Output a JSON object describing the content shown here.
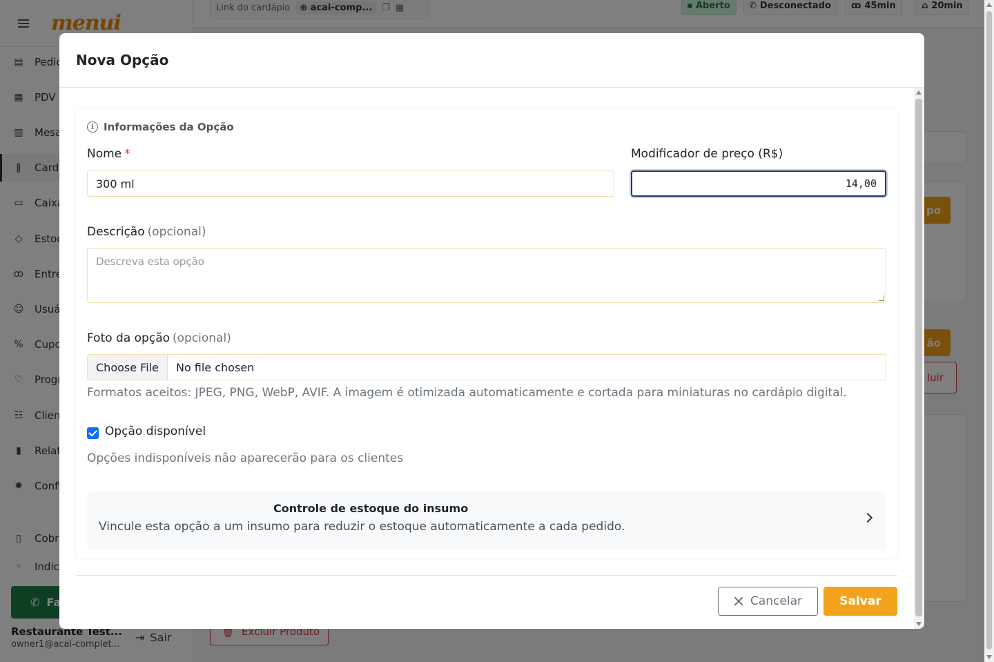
{
  "app": {
    "logo": "menui",
    "sidebar": {
      "items": [
        {
          "label": "Pedic",
          "icon": "receipt-icon"
        },
        {
          "label": "PDV",
          "icon": "calculator-icon"
        },
        {
          "label": "Mesa",
          "icon": "table-icon"
        },
        {
          "label": "Card",
          "icon": "utensils-icon"
        },
        {
          "label": "Caixa",
          "icon": "cash-icon"
        },
        {
          "label": "Estoc",
          "icon": "box-icon"
        },
        {
          "label": "Entre",
          "icon": "bicycle-icon"
        },
        {
          "label": "Usuá",
          "icon": "user-gear-icon"
        },
        {
          "label": "Cupo",
          "icon": "percent-icon"
        },
        {
          "label": "Progr",
          "icon": "heart-icon"
        },
        {
          "label": "Clien",
          "icon": "users-icon"
        },
        {
          "label": "Relat",
          "icon": "chart-icon"
        },
        {
          "label": "Confi",
          "icon": "gear-icon"
        },
        {
          "label": "Cobra",
          "icon": "clipboard-icon"
        },
        {
          "label": "Indic",
          "icon": "indicator-icon"
        }
      ],
      "whatsapp_label": "Fa",
      "user_name": "Restaurante Test...",
      "user_email": "owner1@acai-complet...",
      "logout_label": "Sair"
    },
    "topbar": {
      "menu_link_label": "Link do cardápio",
      "menu_link_url": "acai-comp...",
      "status_open": "Aberto",
      "whatsapp_status": "Desconectado",
      "delivery_time": "45min",
      "pickup_time": "20min"
    },
    "background": {
      "btn_group_label": "po",
      "btn_option_label": "ão",
      "btn_delete_short": "luir",
      "delete_product_label": "Excluir Produto"
    }
  },
  "modal": {
    "title": "Nova Opção",
    "section_title": "Informações da Opção",
    "name": {
      "label": "Nome",
      "required_mark": "*",
      "value": "300 ml"
    },
    "price": {
      "label": "Modificador de preço (R$)",
      "value": "14,00"
    },
    "description": {
      "label": "Descrição",
      "optional": "(opcional)",
      "placeholder": "Descreva esta opção"
    },
    "photo": {
      "label": "Foto da opção",
      "optional": "(opcional)",
      "button": "Choose File",
      "file_status": "No file chosen",
      "help": "Formatos aceitos: JPEG, PNG, WebP, AVIF. A imagem é otimizada automaticamente e cortada para miniaturas no cardápio digital."
    },
    "available": {
      "label": "Opção disponível",
      "checked": true,
      "help": "Opções indisponíveis não aparecerão para os clientes"
    },
    "stock": {
      "title": "Controle de estoque do insumo",
      "description": "Vincule esta opção a um insumo para reduzir o estoque automaticamente a cada pedido."
    },
    "footer": {
      "cancel": "Cancelar",
      "save": "Salvar"
    }
  },
  "colors": {
    "accent": "#f2a31b",
    "brand": "#e88c00",
    "focus": "#1d3d6d",
    "checkbox": "#0d6efd",
    "danger": "#dc3545"
  }
}
